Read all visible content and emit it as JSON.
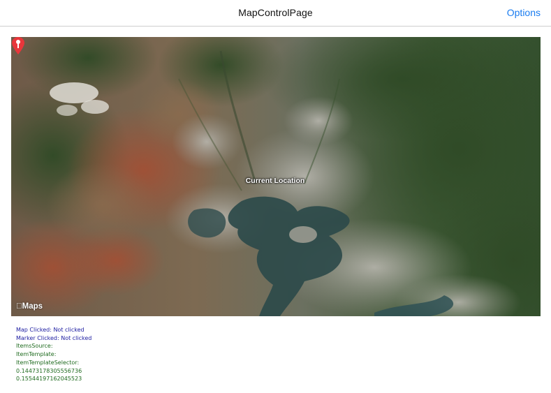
{
  "nav": {
    "title": "MapControlPage",
    "options_label": "Options"
  },
  "map": {
    "attribution": "Maps",
    "marker_label": "Current Location",
    "marker_color": "#e8363b"
  },
  "info": {
    "map_clicked": "Map Clicked: Not clicked",
    "marker_clicked": "Marker Clicked: Not clicked",
    "items_source": "ItemsSource:",
    "item_template": "ItemTemplate:",
    "item_template_selector": "ItemTemplateSelector:",
    "value_1": "0.14473178305556736",
    "value_2": "0.15544197162045523"
  }
}
